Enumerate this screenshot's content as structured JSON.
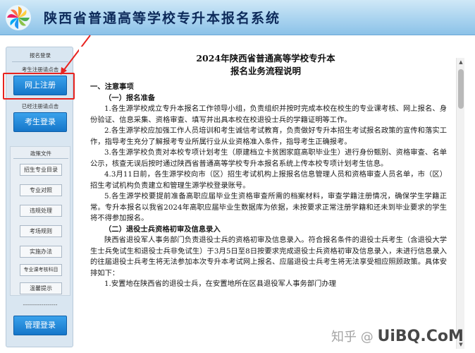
{
  "header": {
    "title": "陕西省普通高等学校专升本报名系统",
    "logo_icon": "pinwheel-logo-icon"
  },
  "sidebar": {
    "registration_label": "报名登录",
    "new_user_hint": "考生注册请点击",
    "register_button": "网上注册",
    "registered_hint": "已经注册请点击",
    "login_button": "考生登录",
    "policy_label": "政策文件",
    "policy_items": [
      "招生专业目录",
      "专业对照",
      "违规处理",
      "考场规则",
      "实施办法",
      "专业课考核科目",
      "温馨提示"
    ],
    "dash_line": "-----------------",
    "admin_button": "管理登录"
  },
  "document": {
    "title_line1": "2024年陕西省普通高等学校专升本",
    "title_line2": "报名业务流程说明",
    "section1": "一、注意事项",
    "sub1": "（一）报名准备",
    "p1": "1.各生源学校成立专升本报名工作领导小组，负责组织并按时完成本校在校生的专业课考核、网上报名、身份验证、信息采集、资格审查、填写并出具本校在校退役士兵的学籍证明等工作。",
    "p2": "2.各生源学校应加强工作人员培训和考生诚信考试教育，负责做好专升本招生考试报名政策的宣传和落实工作，指导考生充分了解报考专业所属行业从业资格准入条件，指导考生正确报考。",
    "p3": "3.各生源学校负责对本校专项计划考生（原建档立卡贫困家庭高职毕业生）进行身份甄别、资格审查、名单公示，核查无误后按时通过陕西省普通高等学校专升本报名系统上传本校专项计划考生信息。",
    "p4": "4.3月11日前，各生源学校向市（区）招生考试机构上报报名信息管理人员和资格审查人员名单，市（区）招生考试机构负责建立和管理生源学校登录账号。",
    "p5": "5.各生源学校要提前准备高职应届毕业生资格审查所需的档案材料，审查学籍注册情况，确保学生学籍正常。专升本报名以我省2024年高职应届毕业生数据库为依据，未按要求正常注册学籍和还未到毕业要求的学生将不得参加报名。",
    "sub2": "（二）退役士兵资格初审及信息录入",
    "p6": "陕西省退役军人事务部门负责退役士兵的资格初审及信息录入。符合报名条件的退役士兵考生（含退役大学生士兵免试生和退役士兵非免试生）于3月5日至8日按要求完成退役士兵资格初审及信息录入，未进行信息录入的往届退役士兵考生将无法参加本次专升本考试网上报名、应届退役士兵考生将无法享受相应照顾政策。具体安排如下：",
    "p7": "1.安置地在陕西省的退役士兵，在安置地所在区县退役军人事务部门办理"
  },
  "watermark": {
    "text": "知乎 @",
    "brand": "UiBQ.CoM"
  },
  "colors": {
    "header_gradient_top": "#cfe8f7",
    "button_blue": "#1576c9",
    "highlight_red": "#e8231f",
    "sidebar_bg": "#d9e6f1"
  }
}
